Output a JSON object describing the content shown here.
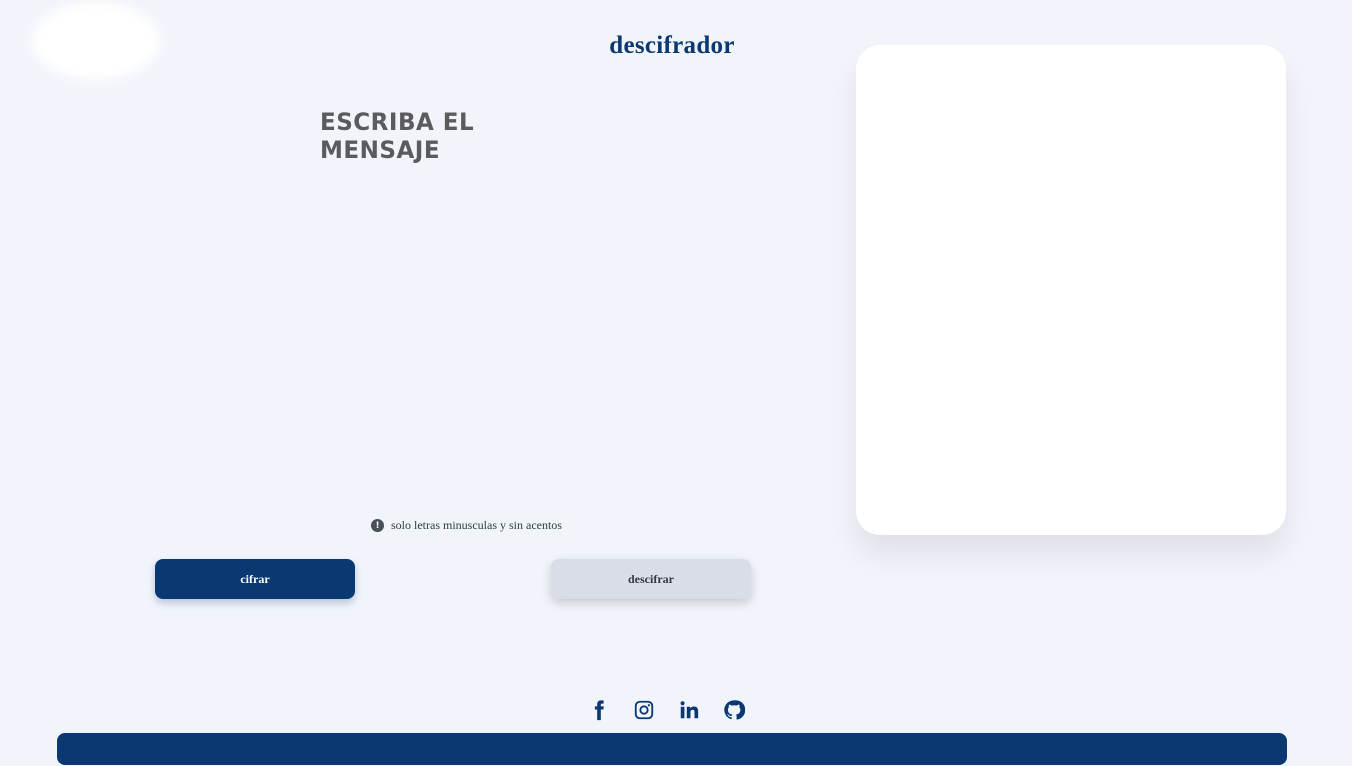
{
  "header": {
    "title": "descifrador"
  },
  "input_panel": {
    "placeholder": "ESCRIBA EL MENSAJE",
    "value": "",
    "hint": "solo letras minusculas y sin acentos",
    "hint_icon": "info-icon"
  },
  "buttons": {
    "encrypt_label": "cifrar",
    "decrypt_label": "descifrar"
  },
  "output_panel": {
    "value": ""
  },
  "social_links": [
    {
      "icon": "facebook-icon"
    },
    {
      "icon": "instagram-icon"
    },
    {
      "icon": "linkedin-icon"
    },
    {
      "icon": "github-icon"
    }
  ],
  "colors": {
    "brand": "#0a3871",
    "background": "#f1f4fb",
    "secondary_button": "#d8dde7",
    "card": "#ffffff",
    "prompt_text": "#5a5a5f"
  }
}
